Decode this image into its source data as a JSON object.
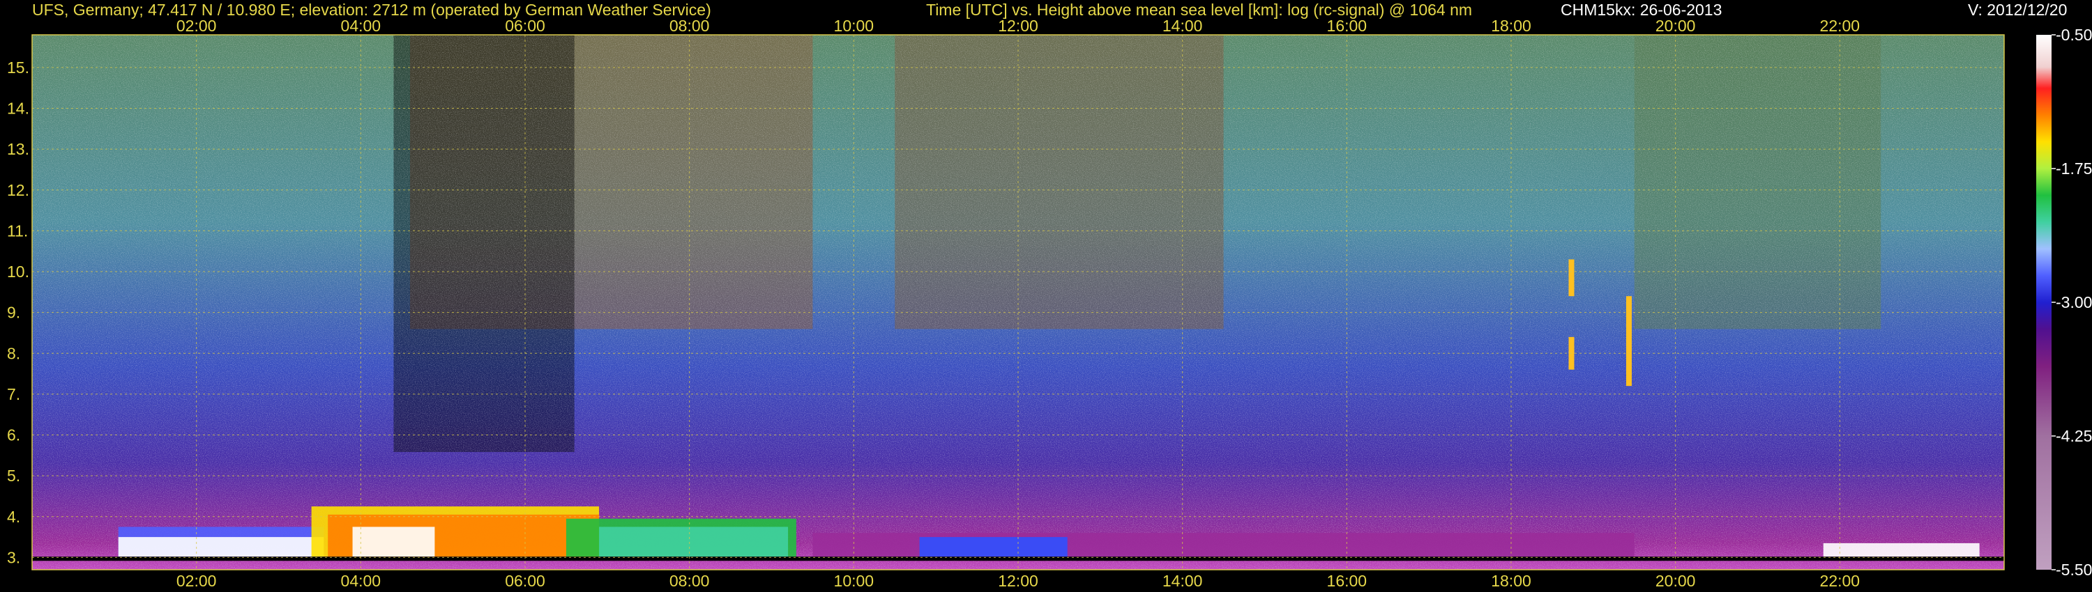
{
  "header": {
    "station": "UFS, Germany; 47.417 N / 10.980 E; elevation: 2712 m  (operated by German Weather Service)",
    "axes_title": "Time [UTC] vs. Height above mean sea level [km]: log (rc-signal) @ 1064 nm",
    "instrument_date": "CHM15kx: 26-06-2013",
    "version": "V: 2012/12/20"
  },
  "colors": {
    "header_text": "#e6d84a",
    "axis_text": "#e6d84a",
    "grid": "#d8c84a",
    "background": "#000000"
  },
  "chart_data": {
    "type": "heatmap",
    "title": "Time [UTC] vs. Height above mean sea level [km]: log (rc-signal) @ 1064 nm",
    "x_ticks": [
      "02:00",
      "04:00",
      "06:00",
      "08:00",
      "10:00",
      "12:00",
      "14:00",
      "16:00",
      "18:00",
      "20:00",
      "22:00"
    ],
    "x_range_hours": [
      0,
      24
    ],
    "y_ticks": [
      3,
      4,
      5,
      6,
      7,
      8,
      9,
      10,
      11,
      12,
      13,
      14,
      15
    ],
    "y_range_km": [
      2.7,
      15.8
    ],
    "grid": true,
    "colorbar": {
      "ticks": [
        "-0.50",
        "-1.75",
        "-3.00",
        "-4.25",
        "-5.50"
      ],
      "range": [
        -5.5,
        -0.5
      ]
    }
  }
}
